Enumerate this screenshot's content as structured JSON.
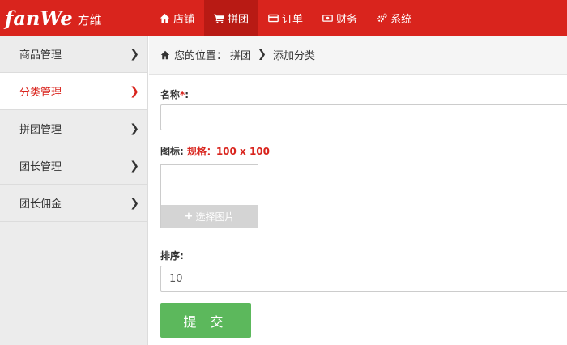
{
  "brand": {
    "logo": "fanWe",
    "logo_cn": "方维"
  },
  "nav": [
    {
      "label": "店铺",
      "icon": "home-icon",
      "active": false
    },
    {
      "label": "拼团",
      "icon": "cart-icon",
      "active": true
    },
    {
      "label": "订单",
      "icon": "card-icon",
      "active": false
    },
    {
      "label": "财务",
      "icon": "money-icon",
      "active": false
    },
    {
      "label": "系统",
      "icon": "gears-icon",
      "active": false
    }
  ],
  "sidebar": {
    "items": [
      {
        "label": "商品管理"
      },
      {
        "label": "分类管理"
      },
      {
        "label": "拼团管理"
      },
      {
        "label": "团长管理"
      },
      {
        "label": "团长佣金"
      }
    ]
  },
  "breadcrumb": {
    "prefix": "您的位置：",
    "parent": "拼团",
    "current": "添加分类"
  },
  "form": {
    "name_label": "名称",
    "name_required": "*",
    "name_colon": ":",
    "name_value": "",
    "icon_label": "图标:",
    "icon_spec": "规格：100 x 100",
    "upload_label": "选择图片",
    "sort_label": "排序:",
    "sort_value": "10",
    "submit_label": "提 交"
  },
  "colors": {
    "brand_red": "#d9241d",
    "active_red": "#b81a14",
    "submit_green": "#5cb85c"
  }
}
